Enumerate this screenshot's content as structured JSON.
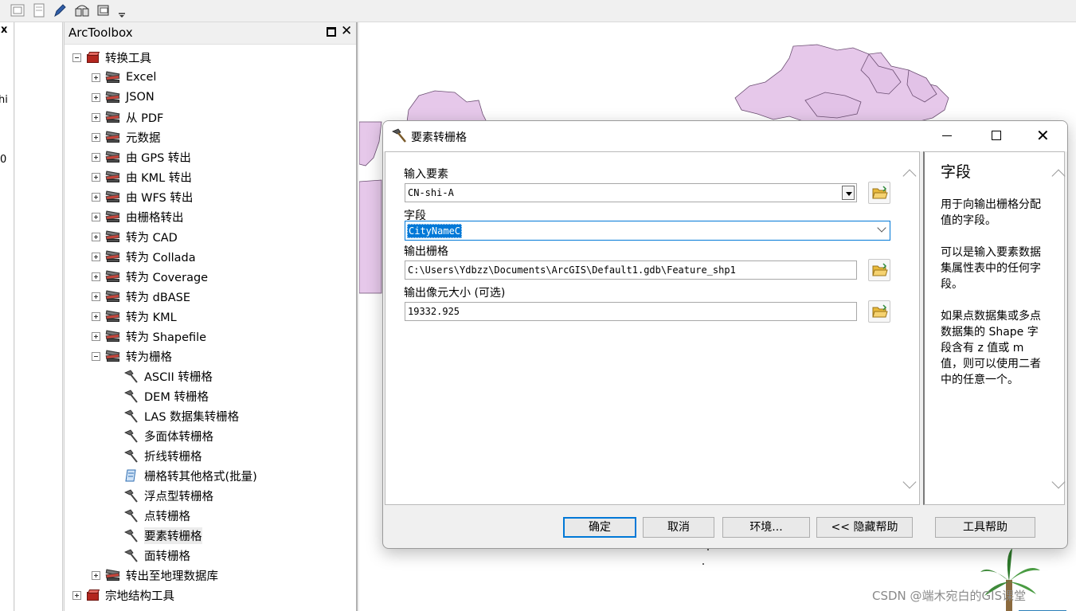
{
  "toolbox": {
    "title": "ArcToolbox",
    "tree": [
      {
        "label": "转换工具",
        "type": "toolbox",
        "expanded": true,
        "level": 0
      },
      {
        "label": "Excel",
        "type": "toolset",
        "level": 1
      },
      {
        "label": "JSON",
        "type": "toolset",
        "level": 1
      },
      {
        "label": "从 PDF",
        "type": "toolset",
        "level": 1
      },
      {
        "label": "元数据",
        "type": "toolset",
        "level": 1
      },
      {
        "label": "由 GPS 转出",
        "type": "toolset",
        "level": 1
      },
      {
        "label": "由 KML 转出",
        "type": "toolset",
        "level": 1
      },
      {
        "label": "由 WFS 转出",
        "type": "toolset",
        "level": 1
      },
      {
        "label": "由栅格转出",
        "type": "toolset",
        "level": 1
      },
      {
        "label": "转为 CAD",
        "type": "toolset",
        "level": 1
      },
      {
        "label": "转为 Collada",
        "type": "toolset",
        "level": 1
      },
      {
        "label": "转为 Coverage",
        "type": "toolset",
        "level": 1
      },
      {
        "label": "转为 dBASE",
        "type": "toolset",
        "level": 1
      },
      {
        "label": "转为 KML",
        "type": "toolset",
        "level": 1
      },
      {
        "label": "转为 Shapefile",
        "type": "toolset",
        "level": 1
      },
      {
        "label": "转为栅格",
        "type": "toolset",
        "expanded": true,
        "level": 1
      },
      {
        "label": "ASCII 转栅格",
        "type": "tool",
        "level": 2
      },
      {
        "label": "DEM 转栅格",
        "type": "tool",
        "level": 2
      },
      {
        "label": "LAS 数据集转栅格",
        "type": "tool",
        "level": 2
      },
      {
        "label": "多面体转栅格",
        "type": "tool",
        "level": 2
      },
      {
        "label": "折线转栅格",
        "type": "tool",
        "level": 2
      },
      {
        "label": "栅格转其他格式(批量)",
        "type": "script",
        "level": 2
      },
      {
        "label": "浮点型转栅格",
        "type": "tool",
        "level": 2
      },
      {
        "label": "点转栅格",
        "type": "tool",
        "level": 2
      },
      {
        "label": "要素转栅格",
        "type": "tool",
        "level": 2,
        "selected": true
      },
      {
        "label": "面转栅格",
        "type": "tool",
        "level": 2
      },
      {
        "label": "转出至地理数据库",
        "type": "toolset",
        "level": 1
      },
      {
        "label": "宗地结构工具",
        "type": "toolbox",
        "level": 0
      }
    ]
  },
  "left_strip": {
    "chars": [
      "x",
      "hi",
      "0"
    ]
  },
  "dialog": {
    "title": "要素转栅格",
    "fields": {
      "input_features_label": "输入要素",
      "input_features_value": "CN-shi-A",
      "field_label": "字段",
      "field_value": "CityNameC",
      "output_raster_label": "输出栅格",
      "output_raster_value": "C:\\Users\\Ydbzz\\Documents\\ArcGIS\\Default1.gdb\\Feature_shp1",
      "cell_size_label": "输出像元大小 (可选)",
      "cell_size_value": "19332.925"
    },
    "help": {
      "title": "字段",
      "paragraphs": [
        "用于向输出栅格分配值的字段。",
        "可以是输入要素数据集属性表中的任何字段。",
        "如果点数据集或多点数据集的 Shape 字段含有 z 值或 m 值，则可以使用二者中的任意一个。"
      ]
    },
    "buttons": {
      "ok": "确定",
      "cancel": "取消",
      "environments": "环境...",
      "hide_help": "<< 隐藏帮助",
      "tool_help": "工具帮助"
    }
  },
  "watermark": "CSDN @端木宛白的GIS课堂",
  "colors": {
    "map_polygon_fill": "#e6c8ea",
    "map_polygon_stroke": "#6b4e72",
    "accent": "#0078d7"
  }
}
